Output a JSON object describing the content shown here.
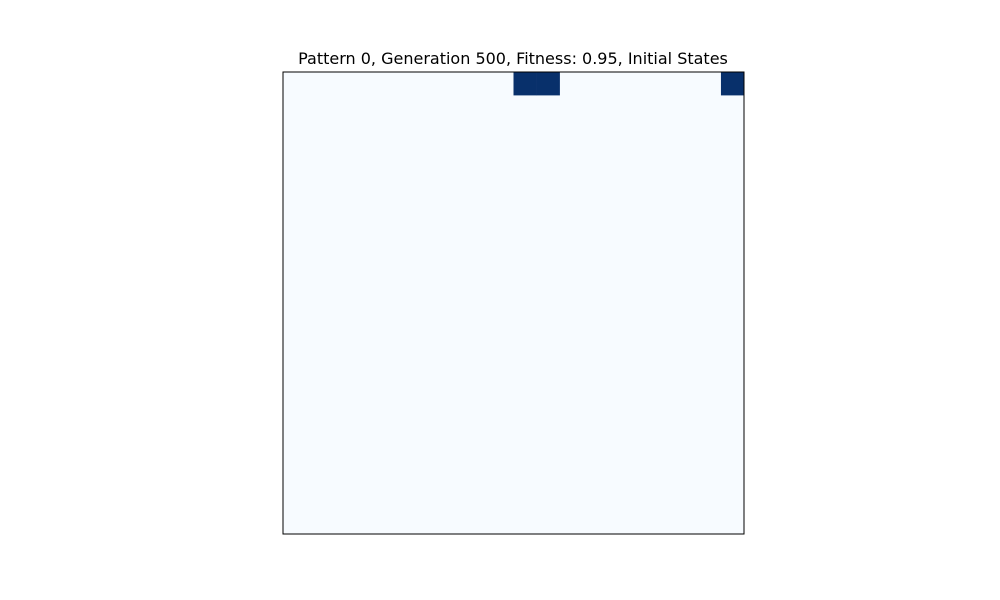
{
  "chart_data": {
    "type": "heatmap",
    "title": "Pattern 0, Generation 500, Fitness: 0.95, Initial States",
    "xlabel": "",
    "ylabel": "",
    "grid": false,
    "axes_ticks": false,
    "colormap": "Blues",
    "colors": {
      "low": "#f7fbff",
      "high": "#08306b",
      "frame": "#000000"
    },
    "rows": 20,
    "cols": 20,
    "active_cells": [
      {
        "row": 0,
        "col": 10,
        "value": 1
      },
      {
        "row": 0,
        "col": 11,
        "value": 1
      },
      {
        "row": 0,
        "col": 19,
        "value": 1
      }
    ]
  }
}
